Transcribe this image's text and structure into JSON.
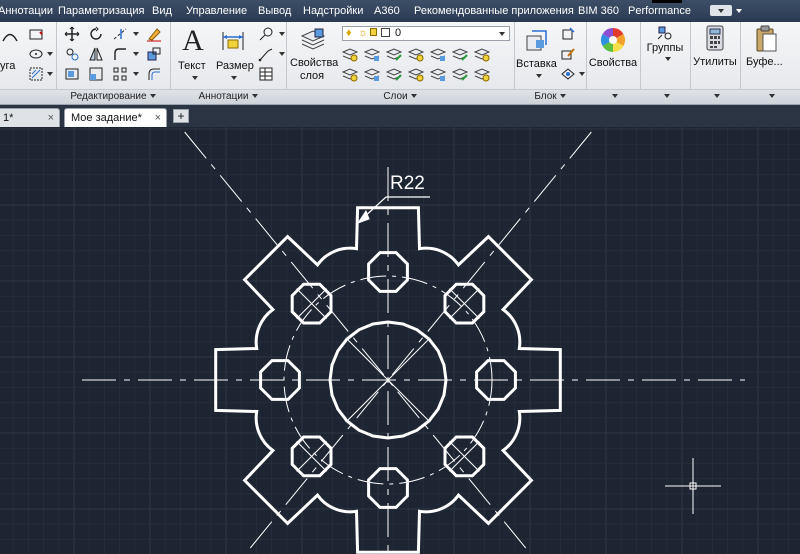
{
  "menubar": {
    "items": [
      "Аннотации",
      "Параметризация",
      "Вид",
      "Управление",
      "Вывод",
      "Надстройки",
      "A360",
      "Рекомендованные приложения",
      "BIM 360",
      "Performance"
    ]
  },
  "ribbon": {
    "draw_partial_label": "уга",
    "panels": {
      "edit": {
        "title": "Редактирование"
      },
      "annotations": {
        "title": "Аннотации",
        "text_label": "Текст",
        "size_label": "Размер"
      },
      "layers": {
        "title": "Слои",
        "properties_label_1": "Свойства",
        "properties_label_2": "слоя",
        "current_layer": "0"
      },
      "block": {
        "title": "Блок",
        "insert_label": "Вставка"
      },
      "properties": {
        "label": "Свойства"
      },
      "groups": {
        "label": "Группы"
      },
      "utilities": {
        "label": "Утилиты"
      },
      "clipboard": {
        "label": "Буфе..."
      }
    }
  },
  "tabs": [
    {
      "label": "1*",
      "close": "×"
    },
    {
      "label": "Мое задание*",
      "close": "×"
    }
  ],
  "tab_add": "+",
  "drawing": {
    "dimension_text": "R22"
  },
  "colors": {
    "canvas_bg": "#1e2532",
    "grid_minor": "#252d3a",
    "grid_major": "#2f3847",
    "lines": "#ffffff"
  }
}
